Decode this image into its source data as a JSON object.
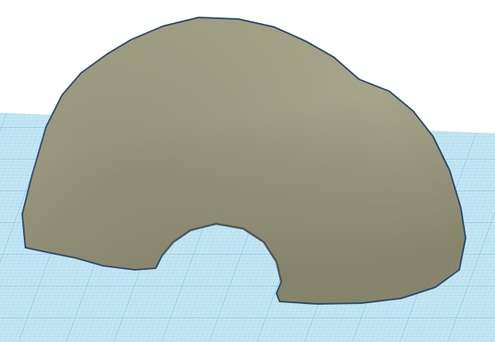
{
  "scene": {
    "object": "rock-cave",
    "colors": {
      "background": "#ffffff",
      "workplane": "#c4e6f4",
      "grid_minor": "#9fd2ea",
      "grid_major": "#6fb8dc",
      "rock_light": "#a8a78c",
      "rock_mid": "#8f8e74",
      "rock_dark": "#6f6e58",
      "outline": "#2e4a66"
    }
  }
}
